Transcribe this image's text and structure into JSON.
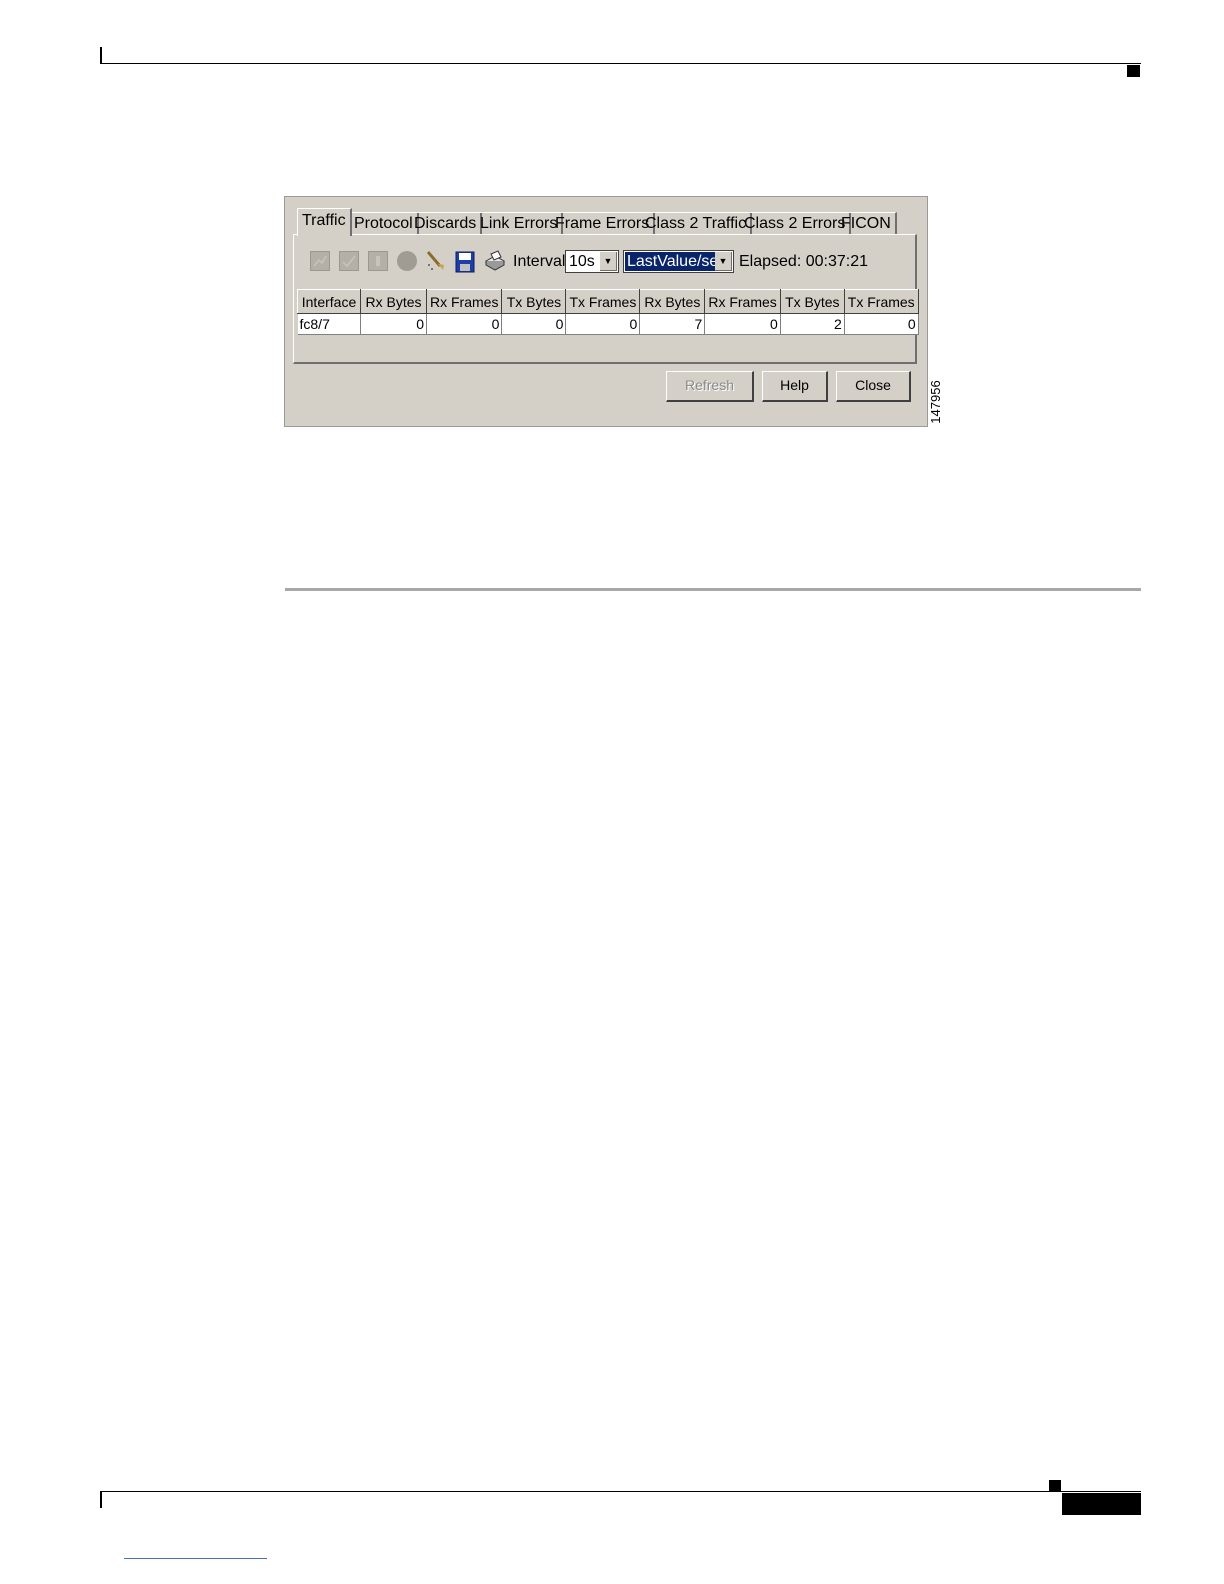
{
  "figure": {
    "number": "147956"
  },
  "dialog": {
    "tabs": [
      {
        "label": "Traffic",
        "active": true
      },
      {
        "label": "Protocol",
        "active": false
      },
      {
        "label": "Discards",
        "active": false
      },
      {
        "label": "Link Errors",
        "active": false
      },
      {
        "label": "Frame Errors",
        "active": false
      },
      {
        "label": "Class 2 Traffic",
        "active": false
      },
      {
        "label": "Class 2 Errors",
        "active": false
      },
      {
        "label": "FICON",
        "active": false
      }
    ],
    "toolbar": {
      "icons": [
        "chart-icon",
        "check-chart-icon",
        "info-icon",
        "record-icon",
        "clear-icon",
        "save-icon",
        "print-icon"
      ],
      "interval_label": "Interval:",
      "interval_value": "10s",
      "mode_value": "LastValue/sec",
      "elapsed_label": "Elapsed: 00:37:21"
    },
    "table": {
      "columns": [
        "Interface",
        "Rx Bytes",
        "Rx Frames",
        "Tx Bytes",
        "Tx Frames",
        "Rx Bytes",
        "Rx Frames",
        "Tx Bytes",
        "Tx Frames"
      ],
      "rows": [
        [
          "fc8/7",
          "0",
          "0",
          "0",
          "0",
          "7",
          "0",
          "2",
          "0"
        ]
      ]
    },
    "buttons": {
      "refresh": "Refresh",
      "help": "Help",
      "close": "Close"
    },
    "colors": {
      "window": "#d4d0c8",
      "selection": "#0a246a"
    }
  }
}
